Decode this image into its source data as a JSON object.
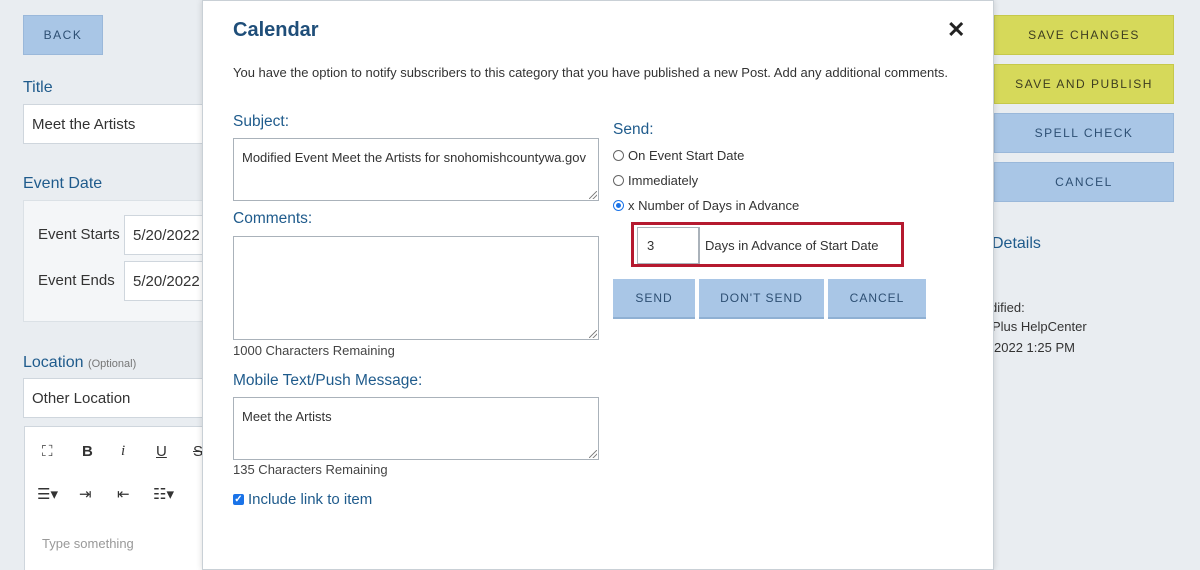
{
  "background": {
    "back_label": "BACK",
    "title_label": "Title",
    "title_value": "Meet the Artists",
    "event_date_label": "Event Date",
    "event_starts_label": "Event Starts",
    "event_starts_value": "5/20/2022",
    "event_ends_label": "Event Ends",
    "event_ends_value": "5/20/2022",
    "location_label": "Location",
    "location_optional": "(Optional)",
    "location_value": "Other Location",
    "editor_placeholder": "Type something",
    "save_changes": "SAVE CHANGES",
    "save_publish": "SAVE AND PUBLISH",
    "spell_check": "SPELL CHECK",
    "cancel": "CANCEL",
    "details_label": "Details",
    "modified_label": "dified:",
    "modified_by": "Plus HelpCenter",
    "modified_date": "2022 1:25 PM"
  },
  "modal": {
    "title": "Calendar",
    "intro": "You have the option to notify subscribers to this category that you have published a new Post. Add any additional comments.",
    "subject_label": "Subject:",
    "subject_value": "Modified Event Meet the Artists for snohomishcountywa.gov",
    "comments_label": "Comments:",
    "comments_value": "",
    "comments_remaining": "1000 Characters Remaining",
    "mobile_label": "Mobile Text/Push Message:",
    "mobile_value": "Meet the Artists",
    "mobile_remaining": "135 Characters Remaining",
    "include_link_label": "Include link to item",
    "include_link_checked": true,
    "send_label": "Send:",
    "send_options": [
      {
        "label": "On Event Start Date",
        "selected": false
      },
      {
        "label": "Immediately",
        "selected": false
      },
      {
        "label": "x Number of Days in Advance",
        "selected": true
      }
    ],
    "days_value": "3",
    "days_suffix": "Days in Advance of Start Date",
    "buttons": {
      "send": "SEND",
      "dont_send": "DON'T SEND",
      "cancel": "CANCEL"
    }
  },
  "colors": {
    "accent": "#1f5b8c",
    "button_blue": "#a9c6e6",
    "button_yellow": "#d6d95a",
    "highlight": "#b5192f"
  }
}
